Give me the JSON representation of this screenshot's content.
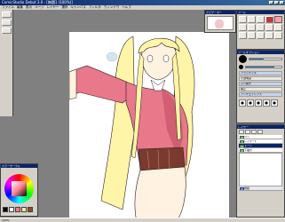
{
  "window": {
    "title": "ComicStudio Debut 3.0 - [無題1 (100%)]"
  },
  "menu": [
    "ファイル",
    "編集",
    "表示",
    "ページ",
    "レイヤー",
    "選択",
    "キャンバス",
    "フィルタ",
    "ウィンドウ",
    "ヘルプ"
  ],
  "navigator": {
    "title": "ナビゲーター"
  },
  "tools": {
    "title": "ツール"
  },
  "brush": {
    "title": "ツールオプション",
    "size_level": 0.45,
    "opacity_level": 0.8,
    "rows": [
      "ブラシサイズ",
      "不透明度",
      "入り抜き",
      "補正",
      "アンチエイリアス"
    ]
  },
  "layers": {
    "title": "レイヤー",
    "items": [
      "ペン",
      "レイヤー1",
      "トーン",
      "下描き",
      "用紙"
    ]
  },
  "color": {
    "title": "カラーサークル",
    "swatches": [
      "#000000",
      "#ffffff",
      "#ff7a8a",
      "#ffe9a0",
      "#8a4d2a"
    ]
  },
  "colors": {
    "hair": "#fff5a8",
    "hair_dark": "#e8c85a",
    "jacket": "#e8788a",
    "jacket_shadow": "#c24c62",
    "skin": "#fff2e0",
    "corset": "#7a3a2e",
    "outline": "#2a1a1a"
  },
  "status": "100%"
}
